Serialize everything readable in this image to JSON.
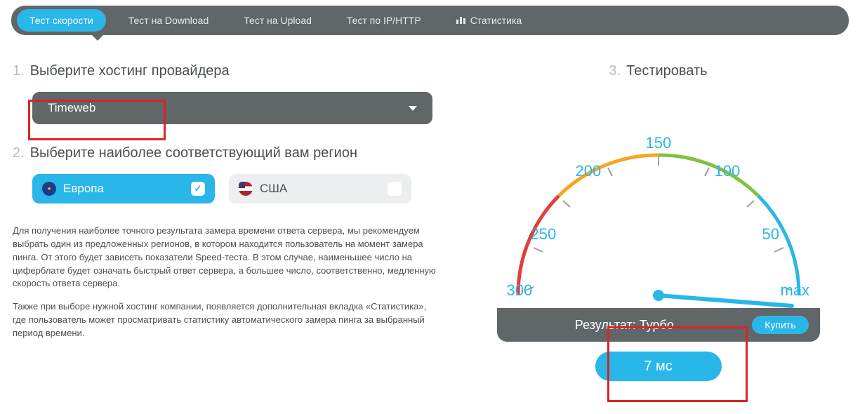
{
  "tabs": {
    "speed": "Тест скорости",
    "download": "Тест на Download",
    "upload": "Тест на Upload",
    "iphttp": "Тест по IP/HTTP",
    "stats": "Статистика"
  },
  "step1": {
    "num": "1.",
    "title": "Выберите хостинг провайдера",
    "provider": "Timeweb"
  },
  "step2": {
    "num": "2.",
    "title": "Выберите наиболее соответствующий вам регион",
    "regions": {
      "europe": "Европа",
      "usa": "США"
    }
  },
  "step3": {
    "num": "3.",
    "title": "Тестировать"
  },
  "desc1": "Для получения наиболее точного результата замера времени ответа сервера, мы рекомендуем выбрать один из предложенных регионов, в котором находится пользователь на момент замера пинга. От этого будет зависеть показатели Speed-теста. В этом случае, наименьшее число на циферблате будет означать быстрый ответ сервера, а большее число, соответственно, медленную скорость ответа сервера.",
  "desc2": "Также при выборе нужной хостинг компании, появляется дополнительная вкладка «Статистика», где пользователь может просматривать статистику автоматического замера пинга за выбранный период времени.",
  "gauge": {
    "ticks": {
      "t300": "300",
      "t250": "250",
      "t200": "200",
      "t150": "150",
      "t100": "100",
      "t50": "50",
      "tmax": "max"
    }
  },
  "result": {
    "label": "Результат: Турбо",
    "buy": "Купить",
    "value": "7 мс"
  }
}
